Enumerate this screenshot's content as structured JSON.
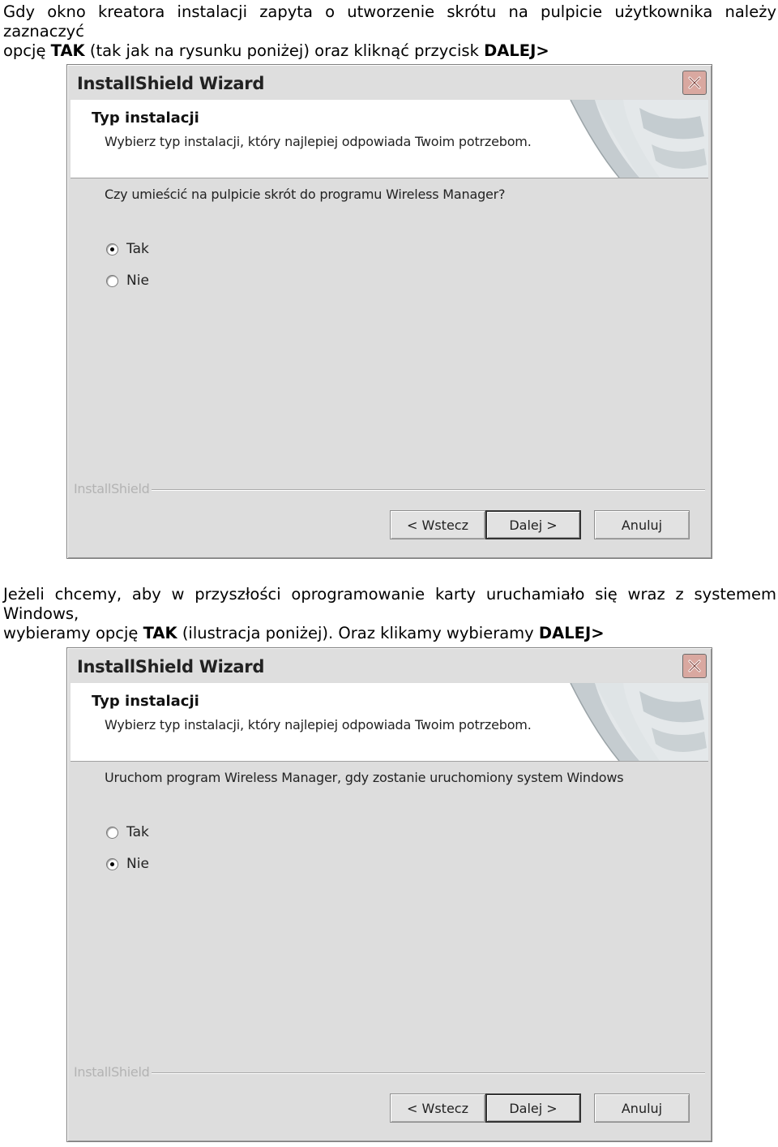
{
  "instructions": {
    "first": {
      "line1": "Gdy okno kreatora instalacji zapyta o utworzenie skrótu na pulpicie użytkownika należy zaznaczyć",
      "line2_prefix": "opcję ",
      "line2_bold": "TAK",
      "line2_middle": " (tak jak na rysunku poniżej) oraz kliknąć przycisk ",
      "line2_bold2": "DALEJ>"
    },
    "second": {
      "line1": "Jeżeli chcemy, aby w przyszłości oprogramowanie karty uruchamiało się wraz z systemem Windows,",
      "line2_prefix": "wybieramy opcję ",
      "line2_bold": "TAK",
      "line2_middle": " (ilustracja poniżej). Oraz klikamy wybieramy ",
      "line2_bold2": "DALEJ>"
    }
  },
  "dialogs": [
    {
      "title": "InstallShield Wizard",
      "header_title": "Typ instalacji",
      "header_subtitle": "Wybierz typ instalacji, który najlepiej odpowiada Twoim potrzebom.",
      "question": "Czy umieścić na pulpicie skrót do programu Wireless Manager?",
      "options": [
        {
          "label": "Tak",
          "checked": true
        },
        {
          "label": "Nie",
          "checked": false
        }
      ],
      "brand": "InstallShield",
      "buttons": {
        "back": "< Wstecz",
        "next": "Dalej >",
        "cancel": "Anuluj"
      }
    },
    {
      "title": "InstallShield Wizard",
      "header_title": "Typ instalacji",
      "header_subtitle": "Wybierz typ instalacji, który najlepiej odpowiada Twoim potrzebom.",
      "question": "Uruchom program Wireless Manager, gdy zostanie uruchomiony system Windows",
      "options": [
        {
          "label": "Tak",
          "checked": false
        },
        {
          "label": "Nie",
          "checked": true
        }
      ],
      "brand": "InstallShield",
      "buttons": {
        "back": "< Wstecz",
        "next": "Dalej >",
        "cancel": "Anuluj"
      }
    }
  ],
  "colors": {
    "dialog_bg": "#dddddd",
    "close_button": "#d9a8a0",
    "brand_text": "#b3b3b3"
  }
}
